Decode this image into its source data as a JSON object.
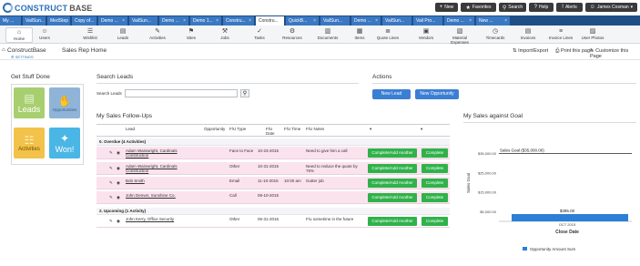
{
  "app": {
    "logo_a": "CONSTRUCT",
    "logo_b": "BASE"
  },
  "topbar": {
    "new": "New",
    "favorites": "Favorites",
    "search": "Search",
    "help": "Help",
    "alerts": "Alerts",
    "user": "James Cosman",
    "icons": {
      "new": "plus-icon",
      "favorites": "star-icon",
      "search": "search-icon",
      "help": "help-icon",
      "alerts": "alert-icon",
      "user": "user-icon"
    }
  },
  "tabs": [
    {
      "label": "My ..."
    },
    {
      "label": "VailSun..."
    },
    {
      "label": "MedStep"
    },
    {
      "label": "Copy of..."
    },
    {
      "label": "Demo ..."
    },
    {
      "label": "VailSun..."
    },
    {
      "label": "Demo ..."
    },
    {
      "label": "Demo 1..."
    },
    {
      "label": "Constru..."
    },
    {
      "label": "Constru..."
    },
    {
      "label": "QuickB..."
    },
    {
      "label": "VailSun..."
    },
    {
      "label": "Demo ..."
    },
    {
      "label": "VailSun..."
    },
    {
      "label": "Vail Pro..."
    },
    {
      "label": "Demo ..."
    },
    {
      "label": "New ..."
    }
  ],
  "iconbar": [
    {
      "label": "Home",
      "icon": "home-icon",
      "glyph": "⌂"
    },
    {
      "label": "Users",
      "icon": "users-icon",
      "glyph": "☺"
    },
    {
      "label": "Wishlist",
      "icon": "wishlist-icon",
      "glyph": "☰"
    },
    {
      "label": "Leads",
      "icon": "leads-icon",
      "glyph": "▤"
    },
    {
      "label": "Activities",
      "icon": "activities-icon",
      "glyph": "✎"
    },
    {
      "label": "Sites",
      "icon": "sites-icon",
      "glyph": "⚑"
    },
    {
      "label": "Jobs",
      "icon": "jobs-icon",
      "glyph": "⚒"
    },
    {
      "label": "Tasks",
      "icon": "tasks-icon",
      "glyph": "✓"
    },
    {
      "label": "Resources",
      "icon": "resources-icon",
      "glyph": "⚙"
    },
    {
      "label": "Documents",
      "icon": "documents-icon",
      "glyph": "▥"
    },
    {
      "label": "Items",
      "icon": "items-icon",
      "glyph": "▦"
    },
    {
      "label": "Quote Lines",
      "icon": "quote-lines-icon",
      "glyph": "≣"
    },
    {
      "label": "Vendors",
      "icon": "vendors-icon",
      "glyph": "▣"
    },
    {
      "label": "Material Expenses",
      "icon": "material-expenses-icon",
      "glyph": "▧"
    },
    {
      "label": "Timecards",
      "icon": "timecards-icon",
      "glyph": "◷"
    },
    {
      "label": "Invoices",
      "icon": "invoices-icon",
      "glyph": "▤"
    },
    {
      "label": "Invoice Lines",
      "icon": "invoice-lines-icon",
      "glyph": "≡"
    },
    {
      "label": "User Photos",
      "icon": "user-photos-icon",
      "glyph": "▨"
    }
  ],
  "crumb": {
    "app": "ConstructBase",
    "settings": "SETTINGS",
    "page": "Sales Rep Home",
    "import": "Import/Export",
    "print": "Print this page",
    "customize": "Customize this Page"
  },
  "gsd": {
    "title": "Get Stuff Done",
    "leads": "Leads",
    "opportunities": "Opportunities",
    "activities": "Activities",
    "won": "Won!"
  },
  "search": {
    "title": "Search Leads",
    "label": "Search Leads",
    "placeholder": ""
  },
  "actions": {
    "title": "Actions",
    "new_lead": "New Lead",
    "new_opportunity": "New Opportunity"
  },
  "followups": {
    "title": "My Sales Follow-Ups",
    "headers": [
      "Lead",
      "Opportunity",
      "F/U Type",
      "F/U Date",
      "F/U Time",
      "F/U Notes"
    ],
    "group1": "0. Overdue (4 Activities)",
    "group2": "2. Upcoming (1 Activity)",
    "complete_add": "Complete/Add Another",
    "complete": "Complete",
    "rows": [
      {
        "lead": "Adam Wainwright, Cardinals Construction",
        "opp": "",
        "type": "Face to Face",
        "date": "10-23-2015",
        "time": "",
        "notes": "Need to give him a call"
      },
      {
        "lead": "Adam Wainwright, Cardinals Construction",
        "opp": "",
        "type": "Other",
        "date": "10-31-2015",
        "time": "",
        "notes": "Need to reduce the quote by 75%"
      },
      {
        "lead": "Bob Smith",
        "opp": "",
        "type": "Email",
        "date": "11-10-2015",
        "time": "10:00 am",
        "notes": "Gutter job"
      },
      {
        "lead": "John Denver, Sunshine Co.",
        "opp": "",
        "type": "Call",
        "date": "09-10-2015",
        "time": "",
        "notes": ""
      },
      {
        "lead": "John Kerry, Office Security",
        "opp": "",
        "type": "Other",
        "date": "05-31-2016",
        "time": "",
        "notes": "F/u sometime in the future"
      }
    ]
  },
  "goal_title": "My Sales against Goal",
  "chart_data": {
    "type": "bar",
    "title": "",
    "categories": [
      "OCT 2015"
    ],
    "series": [
      {
        "name": "Opportunity Amount Sum",
        "values": [
          395
        ]
      }
    ],
    "goal_line": {
      "label": "Sales Goal ($35,000.00)",
      "value": 35000
    },
    "data_labels": [
      "$395.00"
    ],
    "xlabel": "Close Date",
    "ylabel": "Sales Goal",
    "yticks": [
      "$35,000.00",
      "$25,000.00",
      "$15,000.00",
      "$5,000.00"
    ],
    "ylim": [
      0,
      40000
    ],
    "legend": "bottom",
    "colors": {
      "bar": "#2b7fd6",
      "goal": "#222222"
    }
  }
}
